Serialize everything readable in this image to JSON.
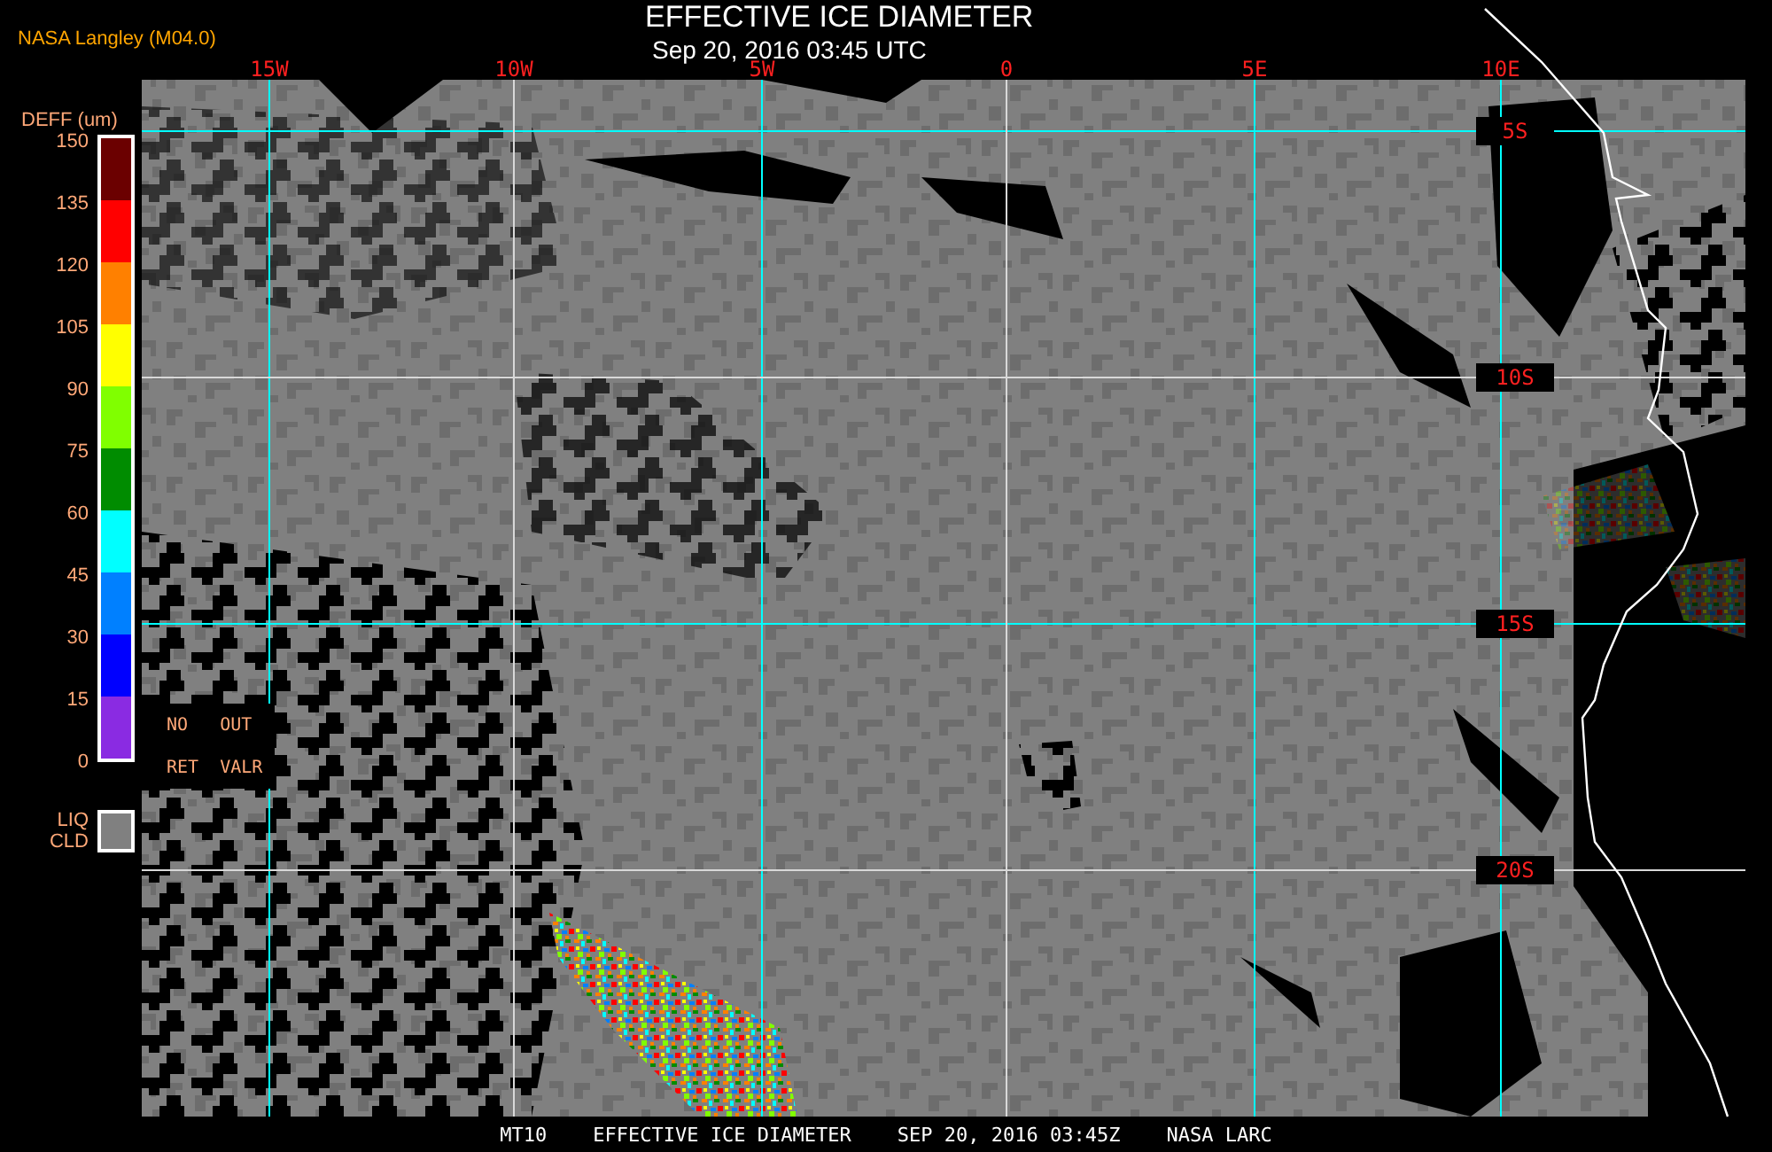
{
  "header": {
    "producer": "NASA Langley (M04.0)",
    "title": "EFFECTIVE ICE DIAMETER",
    "timestamp": "Sep 20, 2016 03:45 UTC"
  },
  "map": {
    "longitude_labels": [
      "15W",
      "10W",
      "5W",
      "0",
      "5E",
      "10E"
    ],
    "latitude_labels": [
      "5S",
      "10S",
      "15S",
      "20S"
    ]
  },
  "legend": {
    "title": "DEFF (um)",
    "ticks": [
      "150",
      "135",
      "120",
      "105",
      "90",
      "75",
      "60",
      "45",
      "30",
      "15",
      "0"
    ],
    "bins": [
      {
        "color": "#6b0000"
      },
      {
        "color": "#ff0000"
      },
      {
        "color": "#ff8000"
      },
      {
        "color": "#ffff00"
      },
      {
        "color": "#80ff00"
      },
      {
        "color": "#008c00"
      },
      {
        "color": "#00ffff"
      },
      {
        "color": "#0080ff"
      },
      {
        "color": "#0000ff"
      },
      {
        "color": "#8a2be2"
      }
    ],
    "flags": [
      {
        "lines": [
          "NO",
          "RET"
        ]
      },
      {
        "lines": [
          "OUT",
          "VALR"
        ]
      }
    ],
    "liquid_cloud": {
      "lines": [
        "LIQ",
        "CLD"
      ]
    }
  },
  "footer": [
    "MT10",
    "EFFECTIVE ICE DIAMETER",
    "SEP 20, 2016 03:45Z",
    "NASA LARC"
  ]
}
